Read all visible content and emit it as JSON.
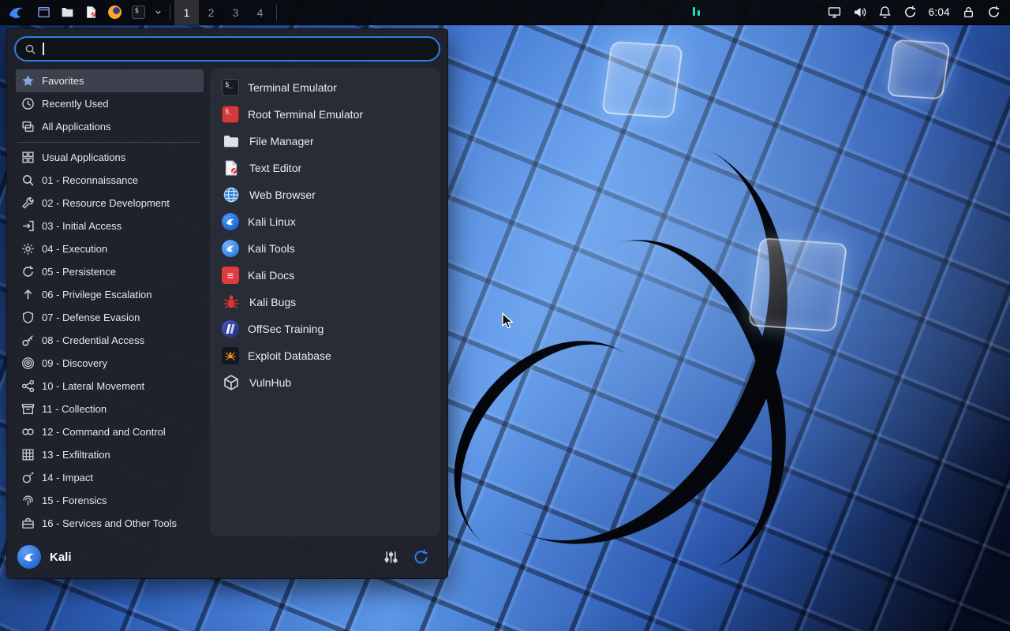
{
  "colors": {
    "accent_blue": "#2e7cf6",
    "kali_blue": "#367bf0",
    "selection_bg": "#3d414d",
    "menu_bg": "#20232b",
    "panel_bg": "#0a0c10",
    "root_terminal_red": "#d23b3b",
    "exploitdb_orange": "#ff8f1f",
    "search_border": "#2d7fe0",
    "indicator_teal": "#17e2c3"
  },
  "panel": {
    "launchers": [
      "whisker-menu",
      "app-finder",
      "file-manager",
      "text-editor",
      "web-browser",
      "terminal"
    ],
    "workspaces": [
      {
        "label": "1",
        "active": true
      },
      {
        "label": "2",
        "active": false
      },
      {
        "label": "3",
        "active": false
      },
      {
        "label": "4",
        "active": false
      }
    ],
    "tray_icons": [
      "display-icon",
      "volume-icon",
      "notifications-icon",
      "updates-icon",
      "lock-icon",
      "session-icon"
    ],
    "clock": "6:04"
  },
  "menu": {
    "search": {
      "placeholder": "",
      "value": ""
    },
    "categories": [
      {
        "label": "Favorites",
        "icon": "star-icon",
        "icon_ref": "#i-star",
        "selected": true
      },
      {
        "label": "Recently Used",
        "icon": "clock-icon",
        "icon_ref": "#i-clock",
        "selected": false
      },
      {
        "label": "All Applications",
        "icon": "windows-icon",
        "icon_ref": "#i-layers",
        "selected": false
      },
      {
        "label": "Usual Applications",
        "icon": "grid-icon",
        "icon_ref": "#i-grid",
        "selected": false
      },
      {
        "label": "01 - Reconnaissance",
        "icon": "magnifier-icon",
        "icon_ref": "#i-magnifier",
        "selected": false
      },
      {
        "label": "02 - Resource Development",
        "icon": "wrench-icon",
        "icon_ref": "#i-wrench",
        "selected": false
      },
      {
        "label": "03 - Initial Access",
        "icon": "door-arrow-icon",
        "icon_ref": "#i-enter",
        "selected": false
      },
      {
        "label": "04 - Execution",
        "icon": "gear-icon",
        "icon_ref": "#i-gear",
        "selected": false
      },
      {
        "label": "05 - Persistence",
        "icon": "loop-icon",
        "icon_ref": "#i-loop",
        "selected": false
      },
      {
        "label": "06 - Privilege Escalation",
        "icon": "arrow-up-icon",
        "icon_ref": "#i-arrow-up",
        "selected": false
      },
      {
        "label": "07 - Defense Evasion",
        "icon": "shield-icon",
        "icon_ref": "#i-shield",
        "selected": false
      },
      {
        "label": "08 - Credential Access",
        "icon": "key-icon",
        "icon_ref": "#i-key",
        "selected": false
      },
      {
        "label": "09 - Discovery",
        "icon": "radar-icon",
        "icon_ref": "#i-radar",
        "selected": false
      },
      {
        "label": "10 - Lateral Movement",
        "icon": "share-icon",
        "icon_ref": "#i-share",
        "selected": false
      },
      {
        "label": "11 - Collection",
        "icon": "archive-icon",
        "icon_ref": "#i-archive",
        "selected": false
      },
      {
        "label": "12 - Command and Control",
        "icon": "link-icon",
        "icon_ref": "#i-link",
        "selected": false
      },
      {
        "label": "13 - Exfiltration",
        "icon": "grid-arrow-icon",
        "icon_ref": "#i-waffle",
        "selected": false
      },
      {
        "label": "14 - Impact",
        "icon": "bomb-icon",
        "icon_ref": "#i-bomb",
        "selected": false
      },
      {
        "label": "15 - Forensics",
        "icon": "fingerprint-icon",
        "icon_ref": "#i-fingerprint",
        "selected": false
      },
      {
        "label": "16 - Services and Other Tools",
        "icon": "toolbox-icon",
        "icon_ref": "#i-toolbox",
        "selected": false
      }
    ],
    "apps": [
      {
        "label": "Terminal Emulator",
        "icon": "terminal-icon"
      },
      {
        "label": "Root Terminal Emulator",
        "icon": "root-terminal-icon"
      },
      {
        "label": "File Manager",
        "icon": "file-manager-icon",
        "icon_ref": "#i-folder"
      },
      {
        "label": "Text Editor",
        "icon": "text-editor-icon",
        "icon_ref": "#i-doc"
      },
      {
        "label": "Web Browser",
        "icon": "web-browser-icon",
        "icon_ref": "#i-globe"
      },
      {
        "label": "Kali Linux",
        "icon": "kali-linux-icon",
        "icon_ref": "#i-swirl"
      },
      {
        "label": "Kali Tools",
        "icon": "kali-tools-icon",
        "icon_ref": "#i-swirl"
      },
      {
        "label": "Kali Docs",
        "icon": "kali-docs-icon"
      },
      {
        "label": "Kali Bugs",
        "icon": "kali-bugs-icon",
        "icon_ref": "#i-bug"
      },
      {
        "label": "OffSec Training",
        "icon": "offsec-icon"
      },
      {
        "label": "Exploit Database",
        "icon": "exploit-db-icon",
        "icon_ref": "#i-spider"
      },
      {
        "label": "VulnHub",
        "icon": "vulnhub-icon",
        "icon_ref": "#i-cube"
      }
    ],
    "footer": {
      "username": "Kali"
    }
  }
}
